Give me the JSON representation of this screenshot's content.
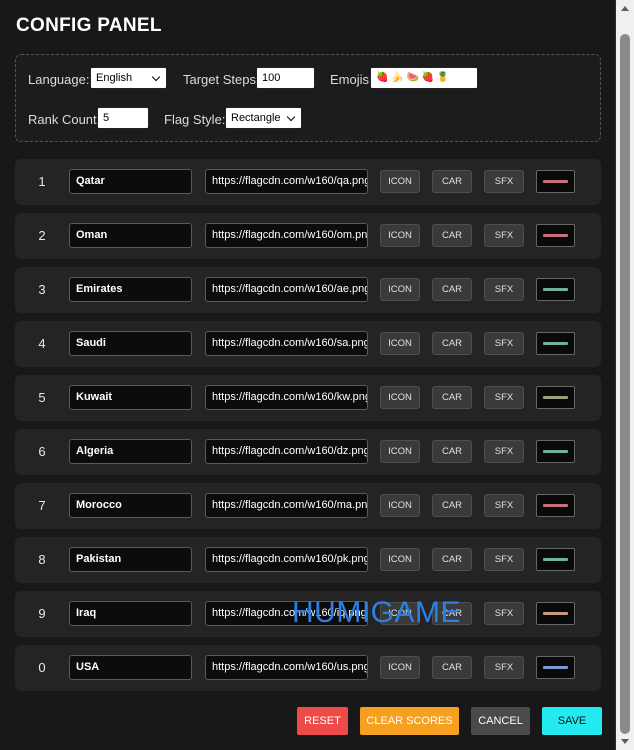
{
  "title": "CONFIG PANEL",
  "settings": {
    "language_label": "Language:",
    "language_value": "English",
    "target_steps_label": "Target Steps:",
    "target_steps_value": "100",
    "emojis_label": "Emojis:",
    "emojis_value": "🍓 🍌 🍉 🍓 🍍",
    "rank_count_label": "Rank Count:",
    "rank_count_value": "5",
    "flag_style_label": "Flag Style:",
    "flag_style_value": "Rectangle"
  },
  "rows": [
    {
      "rank": "1",
      "name": "Qatar",
      "url": "https://flagcdn.com/w160/qa.png",
      "icon": "ICON",
      "car": "CAR",
      "sfx": "SFX",
      "color": "#c9707c"
    },
    {
      "rank": "2",
      "name": "Oman",
      "url": "https://flagcdn.com/w160/om.png",
      "icon": "ICON",
      "car": "CAR",
      "sfx": "SFX",
      "color": "#c9707c"
    },
    {
      "rank": "3",
      "name": "Emirates",
      "url": "https://flagcdn.com/w160/ae.png",
      "icon": "ICON",
      "car": "CAR",
      "sfx": "SFX",
      "color": "#6fb0a0"
    },
    {
      "rank": "4",
      "name": "Saudi",
      "url": "https://flagcdn.com/w160/sa.png",
      "icon": "ICON",
      "car": "CAR",
      "sfx": "SFX",
      "color": "#6fb0a0"
    },
    {
      "rank": "5",
      "name": "Kuwait",
      "url": "https://flagcdn.com/w160/kw.png",
      "icon": "ICON",
      "car": "CAR",
      "sfx": "SFX",
      "color": "#9aa07a"
    },
    {
      "rank": "6",
      "name": "Algeria",
      "url": "https://flagcdn.com/w160/dz.png",
      "icon": "ICON",
      "car": "CAR",
      "sfx": "SFX",
      "color": "#6fb0a0"
    },
    {
      "rank": "7",
      "name": "Morocco",
      "url": "https://flagcdn.com/w160/ma.png",
      "icon": "ICON",
      "car": "CAR",
      "sfx": "SFX",
      "color": "#c9707c"
    },
    {
      "rank": "8",
      "name": "Pakistan",
      "url": "https://flagcdn.com/w160/pk.png",
      "icon": "ICON",
      "car": "CAR",
      "sfx": "SFX",
      "color": "#6fb0a0"
    },
    {
      "rank": "9",
      "name": "Iraq",
      "url": "https://flagcdn.com/w160/iq.png",
      "icon": "ICON",
      "car": "CAR",
      "sfx": "SFX",
      "color": "#c99a80"
    },
    {
      "rank": "0",
      "name": "USA",
      "url": "https://flagcdn.com/w160/us.png",
      "icon": "ICON",
      "car": "CAR",
      "sfx": "SFX",
      "color": "#7a9ad0"
    }
  ],
  "watermark": "HUMIGAME",
  "actions": {
    "reset": "RESET",
    "clear_scores": "CLEAR SCORES",
    "cancel": "CANCEL",
    "save": "SAVE"
  }
}
